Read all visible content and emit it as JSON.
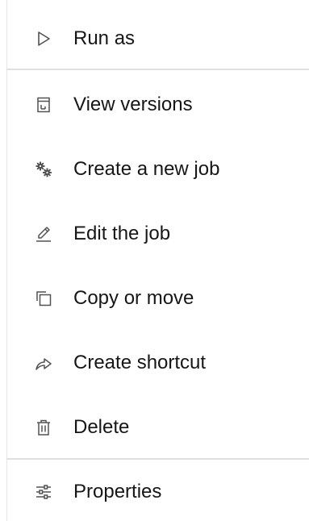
{
  "menu": {
    "items": [
      {
        "label": "Run as",
        "icon": "play-outline-icon"
      },
      {
        "label": "View versions",
        "icon": "versions-icon"
      },
      {
        "label": "Create a new job",
        "icon": "settings-gears-icon"
      },
      {
        "label": "Edit the job",
        "icon": "edit-pencil-icon"
      },
      {
        "label": "Copy or move",
        "icon": "copy-icon"
      },
      {
        "label": "Create shortcut",
        "icon": "shortcut-arrow-icon"
      },
      {
        "label": "Delete",
        "icon": "trash-icon"
      },
      {
        "label": "Properties",
        "icon": "sliders-icon"
      }
    ]
  },
  "colors": {
    "text": "#161616",
    "icon": "#525252",
    "divider": "#e0e0e0",
    "background": "#ffffff"
  }
}
